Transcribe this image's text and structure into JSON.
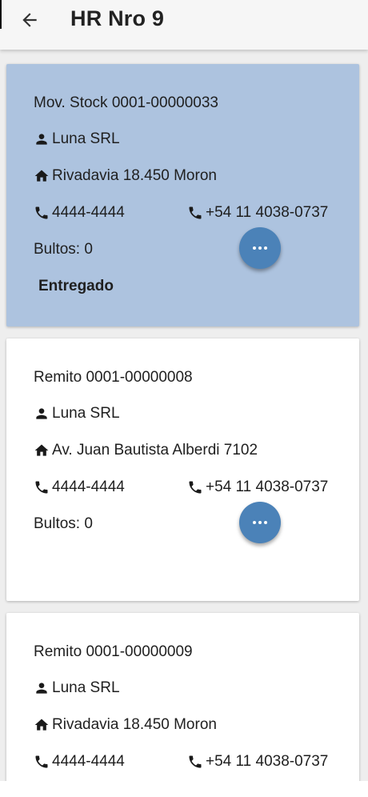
{
  "appbar": {
    "title": "HR Nro 9",
    "back_icon": "arrow-left-icon"
  },
  "colors": {
    "selected_card": "#adc3df",
    "fab": "#4b82b8",
    "card": "#ffffff",
    "background": "#eeeeee"
  },
  "cards": [
    {
      "title": "Mov. Stock 0001-00000033",
      "client": "Luna SRL",
      "address": "Rivadavia 18.450 Moron",
      "phone1": "4444-4444",
      "phone2": "+54 11 4038-0737",
      "bultos": "Bultos: 0",
      "status": "Entregado",
      "selected": true,
      "menu_icon": "more-horizontal-icon"
    },
    {
      "title": "Remito 0001-00000008",
      "client": "Luna SRL",
      "address": "Av. Juan Bautista Alberdi 7102",
      "phone1": "4444-4444",
      "phone2": "+54 11 4038-0737",
      "bultos": "Bultos: 0",
      "status": "",
      "selected": false,
      "menu_icon": "more-horizontal-icon"
    },
    {
      "title": "Remito 0001-00000009",
      "client": "Luna SRL",
      "address": "Rivadavia 18.450 Moron",
      "phone1": "4444-4444",
      "phone2": "+54 11 4038-0737",
      "bultos": "",
      "status": "",
      "selected": false,
      "menu_icon": "more-horizontal-icon"
    }
  ]
}
